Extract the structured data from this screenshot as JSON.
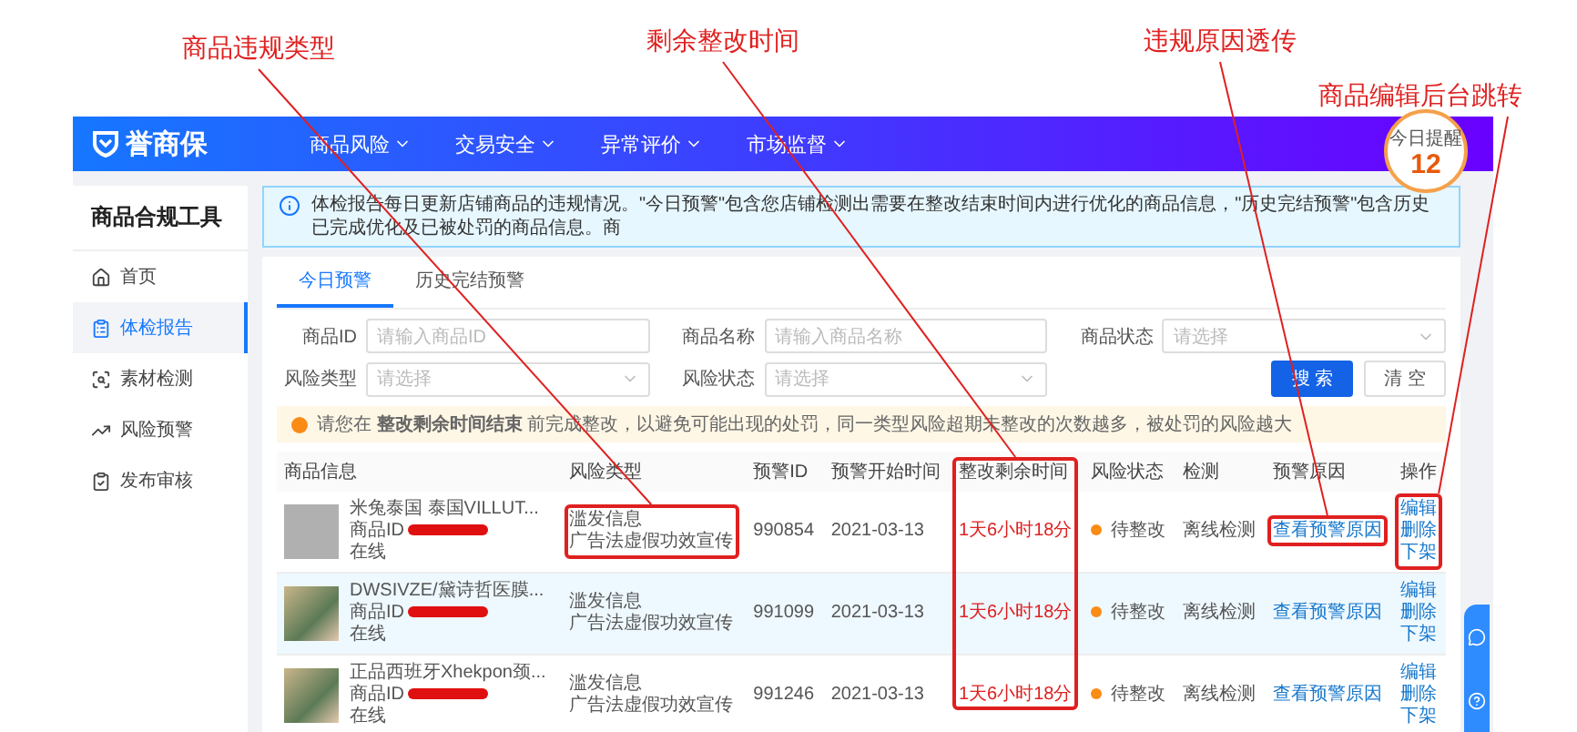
{
  "annotations": [
    {
      "text": "商品违规类型"
    },
    {
      "text": "剩余整改时间"
    },
    {
      "text": "违规原因透传"
    },
    {
      "text": "商品编辑后台跳转"
    }
  ],
  "header": {
    "logo": "誉商保",
    "nav": [
      {
        "label": "商品风险"
      },
      {
        "label": "交易安全"
      },
      {
        "label": "异常评价"
      },
      {
        "label": "市场监督"
      }
    ],
    "reminder": {
      "label": "今日提醒",
      "count": "12"
    }
  },
  "sidebar": {
    "title": "商品合规工具",
    "items": [
      {
        "label": "首页",
        "selected": false
      },
      {
        "label": "体检报告",
        "selected": true
      },
      {
        "label": "素材检测",
        "selected": false
      },
      {
        "label": "风险预警",
        "selected": false
      },
      {
        "label": "发布审核",
        "selected": false
      }
    ]
  },
  "info_banner": "体检报告每日更新店铺商品的违规情况。\"今日预警\"包含您店铺检测出需要在整改结束时间内进行优化的商品信息，\"历史完结预警\"包含历史已完成优化及已被处罚的商品信息。商",
  "tabs": [
    {
      "label": "今日预警",
      "selected": true
    },
    {
      "label": "历史完结预警",
      "selected": false
    }
  ],
  "filters": [
    {
      "label": "商品ID",
      "kind": "input",
      "placeholder": "请输入商品ID"
    },
    {
      "label": "商品名称",
      "kind": "input",
      "placeholder": "请输入商品名称"
    },
    {
      "label": "商品状态",
      "kind": "select",
      "placeholder": "请选择"
    },
    {
      "label": "风险类型",
      "kind": "select",
      "placeholder": "请选择"
    },
    {
      "label": "风险状态",
      "kind": "select",
      "placeholder": "请选择"
    }
  ],
  "buttons": [
    {
      "label": "搜 索",
      "kind": "primary"
    },
    {
      "label": "清 空",
      "kind": "default"
    }
  ],
  "warning": "请您在 **整改剩余时间结束** 前完成整改，以避免可能出现的处罚，同一类型风险超期未整改的次数越多，被处罚的风险越大",
  "table": {
    "columns": [
      "商品信息",
      "风险类型",
      "预警ID",
      "预警开始时间",
      "整改剩余时间",
      "风险状态",
      "检测",
      "预警原因",
      "操作"
    ],
    "rows": [
      {
        "title": "米兔泰国 泰国VILLUT...",
        "id_label": "商品ID",
        "status": "在线",
        "risk_type": [
          "滥发信息",
          "广告法虚假功效宣传"
        ],
        "alert_id": "990854",
        "start": "2021-03-13",
        "remaining": "1天6小时18分",
        "risk_state": "待整改",
        "detect": "离线检测",
        "reason": "查看预警原因",
        "actions": [
          "编辑",
          "删除",
          "下架"
        ],
        "hovered": false
      },
      {
        "title": "DWSIVZE/黛诗哲医膜...",
        "id_label": "商品ID",
        "status": "在线",
        "risk_type": [
          "滥发信息",
          "广告法虚假功效宣传"
        ],
        "alert_id": "991099",
        "start": "2021-03-13",
        "remaining": "1天6小时18分",
        "risk_state": "待整改",
        "detect": "离线检测",
        "reason": "查看预警原因",
        "actions": [
          "编辑",
          "删除",
          "下架"
        ],
        "hovered": true
      },
      {
        "title": "正品西班牙Xhekpon颈...",
        "id_label": "商品ID",
        "status": "在线",
        "risk_type": [
          "滥发信息",
          "广告法虚假功效宣传"
        ],
        "alert_id": "991246",
        "start": "2021-03-13",
        "remaining": "1天6小时18分",
        "risk_state": "待整改",
        "detect": "离线检测",
        "reason": "查看预警原因",
        "actions": [
          "编辑",
          "删除",
          "下架"
        ],
        "hovered": false
      }
    ]
  }
}
